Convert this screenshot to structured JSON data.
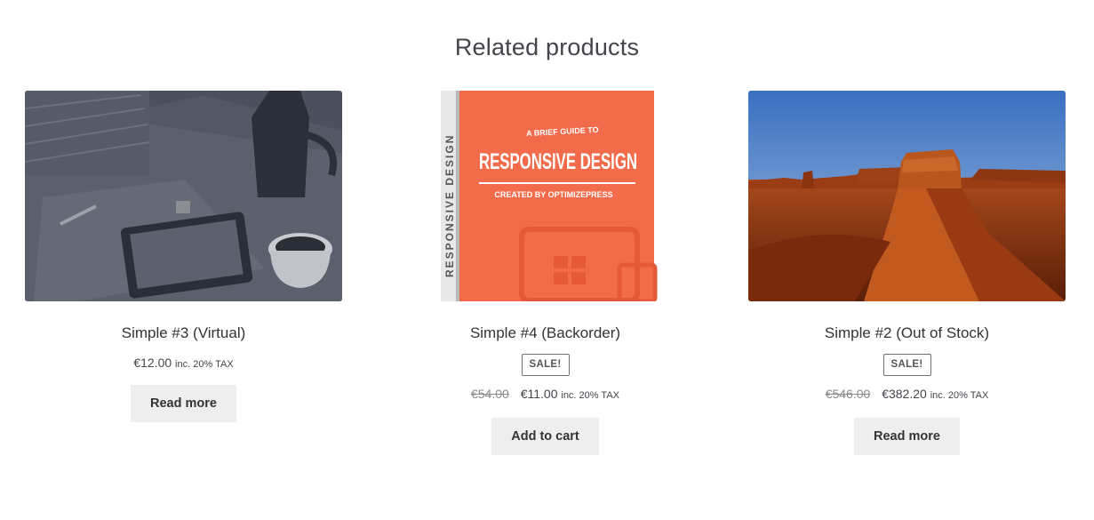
{
  "section": {
    "title": "Related products"
  },
  "products": [
    {
      "title": "Simple #3 (Virtual)",
      "sale_badge": null,
      "old_price": null,
      "price": "€12.00",
      "tax": "inc. 20% TAX",
      "button": "Read more",
      "image_icon": "desk-tablet-coffee-photo"
    },
    {
      "title": "Simple #4 (Backorder)",
      "sale_badge": "SALE!",
      "old_price": "€54.00",
      "price": "€11.00",
      "tax": "inc. 20% TAX",
      "button": "Add to cart",
      "image_icon": "responsive-design-book-cover",
      "image_text": {
        "spine": "RESPONSIVE DESIGN",
        "top": "A BRIEF GUIDE TO",
        "main": "RESPONSIVE DESIGN",
        "sub": "CREATED BY OPTIMIZEPRESS"
      }
    },
    {
      "title": "Simple #2 (Out of Stock)",
      "sale_badge": "SALE!",
      "old_price": "€546.00",
      "price": "€382.20",
      "tax": "inc. 20% TAX",
      "button": "Read more",
      "image_icon": "desert-butte-landscape-photo"
    }
  ],
  "colors": {
    "button_bg": "#eeeeee",
    "book_orange": "#f26b4a",
    "overlay_dark": "#3e4452"
  }
}
